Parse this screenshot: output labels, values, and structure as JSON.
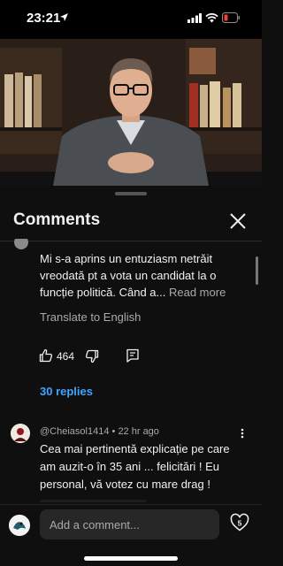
{
  "status_bar": {
    "time": "23:21"
  },
  "sheet": {
    "title": "Comments"
  },
  "comments": [
    {
      "text": "Mi s-a aprins un entuziasm netrăit vreodată pt a vota un candidat la o funcție politică. Când a...",
      "read_more": "Read more",
      "translate": "Translate to English",
      "likes": "464",
      "replies": "30 replies"
    },
    {
      "author": "@Cheiasol1414",
      "separator": "•",
      "time": "22 hr ago",
      "text": "Cea mai pertinentă explicație pe care am auzit-o în 35 ani ... felicitări ! Eu personal, vă votez cu mare drag !"
    }
  ],
  "composer": {
    "placeholder": "Add a comment...",
    "heart_count": "5"
  },
  "colors": {
    "accent": "#3ea6ff",
    "background": "#0f0f0f",
    "secondary_text": "#aaaaaa",
    "battery_low": "#ff3b30"
  }
}
